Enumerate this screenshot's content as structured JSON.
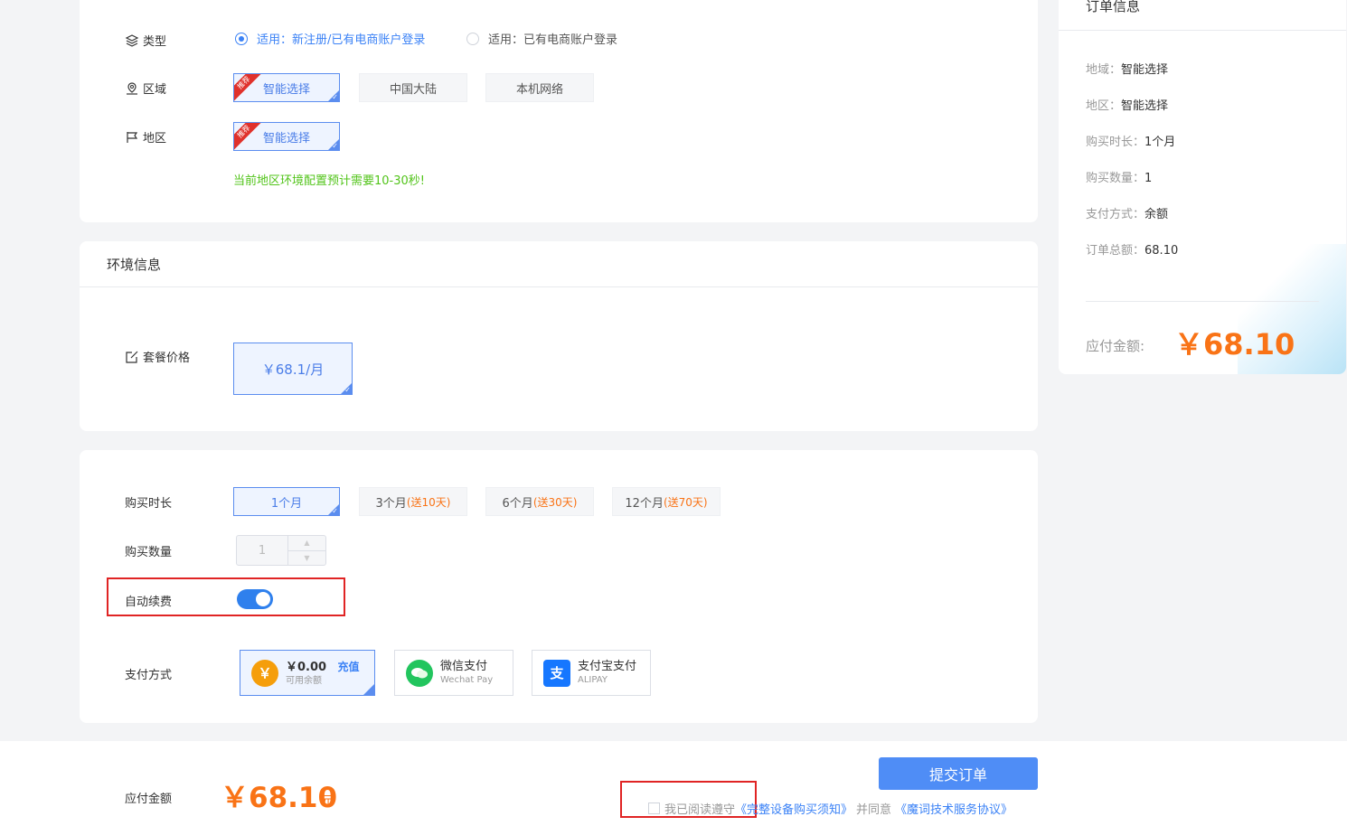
{
  "config": {
    "type_label": "类型",
    "type_options": [
      "适用：新注册/已有电商账户登录",
      "适用：已有电商账户登录"
    ],
    "region_label": "区域",
    "region_options": [
      "智能选择",
      "中国大陆",
      "本机网络"
    ],
    "area_label": "地区",
    "area_options": [
      "智能选择"
    ],
    "ribbon": "推荐",
    "notice": "当前地区环境配置预计需要10-30秒!"
  },
  "env": {
    "title": "环境信息",
    "package_label": "套餐价格",
    "package_price": "￥68.1/月"
  },
  "purchase": {
    "duration_label": "购买时长",
    "durations": [
      {
        "main": "1个月",
        "extra": ""
      },
      {
        "main": "3个月",
        "extra": "(送10天)"
      },
      {
        "main": "6个月",
        "extra": "(送30天)"
      },
      {
        "main": "12个月",
        "extra": "(送70天)"
      }
    ],
    "quantity_label": "购买数量",
    "quantity_value": "1",
    "auto_renew_label": "自动续费",
    "pay_label": "支付方式",
    "balance_amount": "￥0.00",
    "recharge": "充值",
    "balance_sub": "可用余额",
    "wechat_main": "微信支付",
    "wechat_sub": "Wechat Pay",
    "alipay_main": "支付宝支付",
    "alipay_sub": "ALIPAY",
    "yuan_symbol": "￥"
  },
  "order": {
    "title": "订单信息",
    "rows": [
      {
        "k": "地域：",
        "v": "智能选择"
      },
      {
        "k": "地区：",
        "v": "智能选择"
      },
      {
        "k": "购买时长：",
        "v": "1个月"
      },
      {
        "k": "购买数量：",
        "v": "1"
      },
      {
        "k": "支付方式：",
        "v": "余额"
      },
      {
        "k": "订单总额：",
        "v": "68.10"
      }
    ],
    "payable_label": "应付金额:",
    "payable_value": "￥68.10"
  },
  "footer": {
    "payable_label": "应付金额",
    "price": "￥68.10",
    "unit": "元",
    "submit": "提交订单",
    "agree_text": "我已阅读遵守",
    "link1": "《完整设备购买须知》",
    "and_text": "并同意",
    "link2": "《魔词技术服务协议》"
  },
  "colors": {
    "accent": "#3b82f6",
    "price": "#f97316",
    "notice": "#52c41a",
    "highlight": "#e02424"
  }
}
